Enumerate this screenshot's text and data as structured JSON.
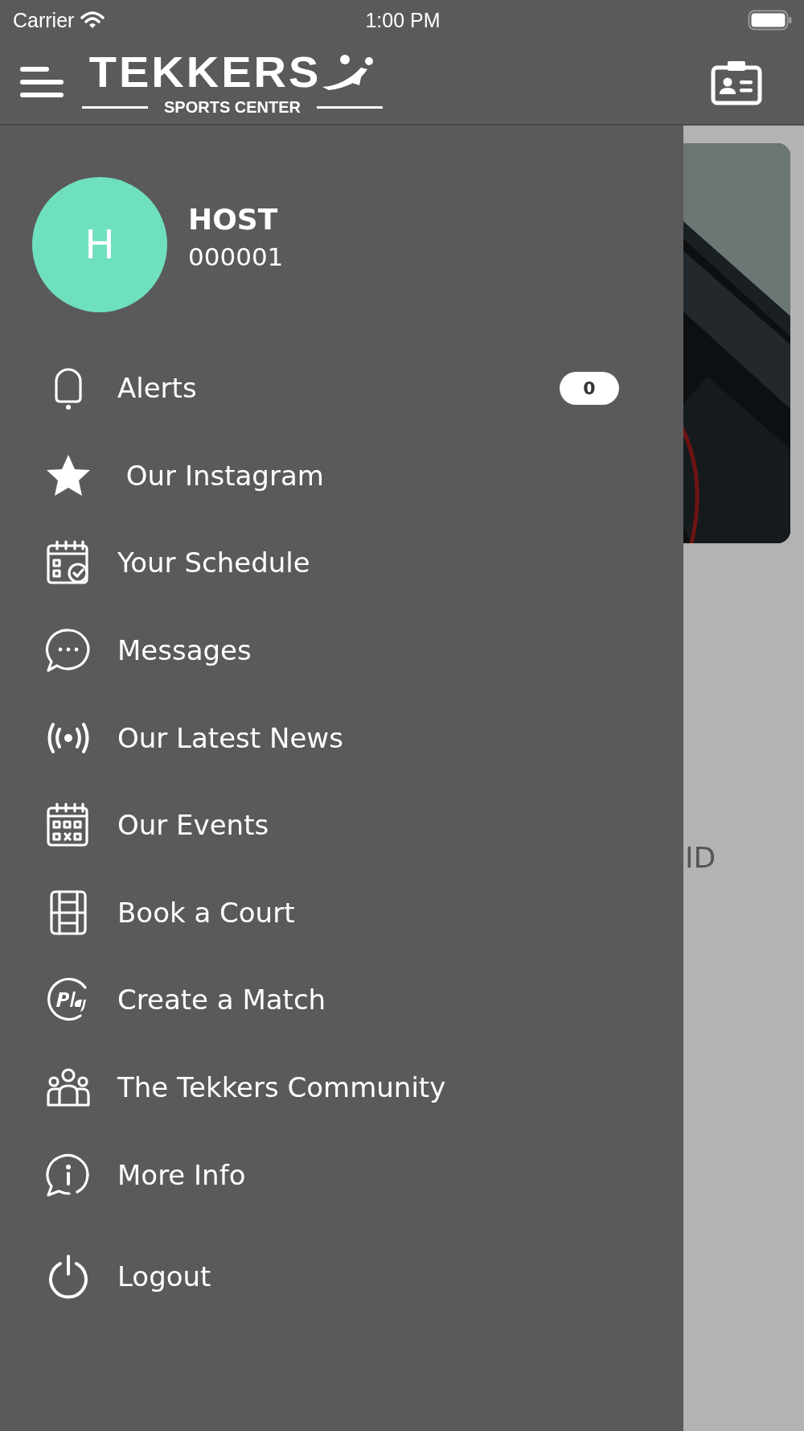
{
  "status_bar": {
    "carrier": "Carrier",
    "time": "1:00 PM"
  },
  "header": {
    "logo": {
      "name": "TEKKERS",
      "tagline": "SPORTS CENTER"
    }
  },
  "profile": {
    "initial": "H",
    "name": "HOST",
    "member_id": "000001"
  },
  "menu": [
    {
      "label": "Alerts",
      "badge": "0"
    },
    {
      "label": " Our Instagram"
    },
    {
      "label": "Your Schedule"
    },
    {
      "label": "Messages"
    },
    {
      "label": "Our Latest News"
    },
    {
      "label": "Our Events"
    },
    {
      "label": "Book a Court"
    },
    {
      "label": "Create a Match"
    },
    {
      "label": "The Tekkers Community"
    },
    {
      "label": "More Info"
    }
  ],
  "logout": {
    "label": "Logout"
  },
  "background_text": "ID"
}
